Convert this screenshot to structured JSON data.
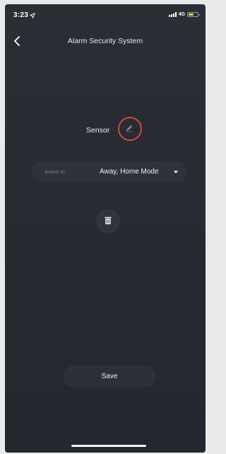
{
  "status_bar": {
    "time": "3:23",
    "network": "4G",
    "icons": [
      "location-arrow-icon",
      "signal-icon",
      "battery-icon"
    ]
  },
  "nav": {
    "title": "Alarm Security System",
    "back_icon": "chevron-left-icon"
  },
  "sensor": {
    "name": "Sensor",
    "edit_icon": "pencil-icon",
    "highlight_color": "#d6463a"
  },
  "active_in": {
    "label": "Active In",
    "value": "Away, Home Mode",
    "caret_icon": "caret-down-icon"
  },
  "delete": {
    "icon": "trash-icon"
  },
  "footer": {
    "save_label": "Save"
  },
  "colors": {
    "background": "#262b31",
    "text_primary": "#eef0f2",
    "text_muted": "#7d858d",
    "battery": "#f1d24a"
  }
}
